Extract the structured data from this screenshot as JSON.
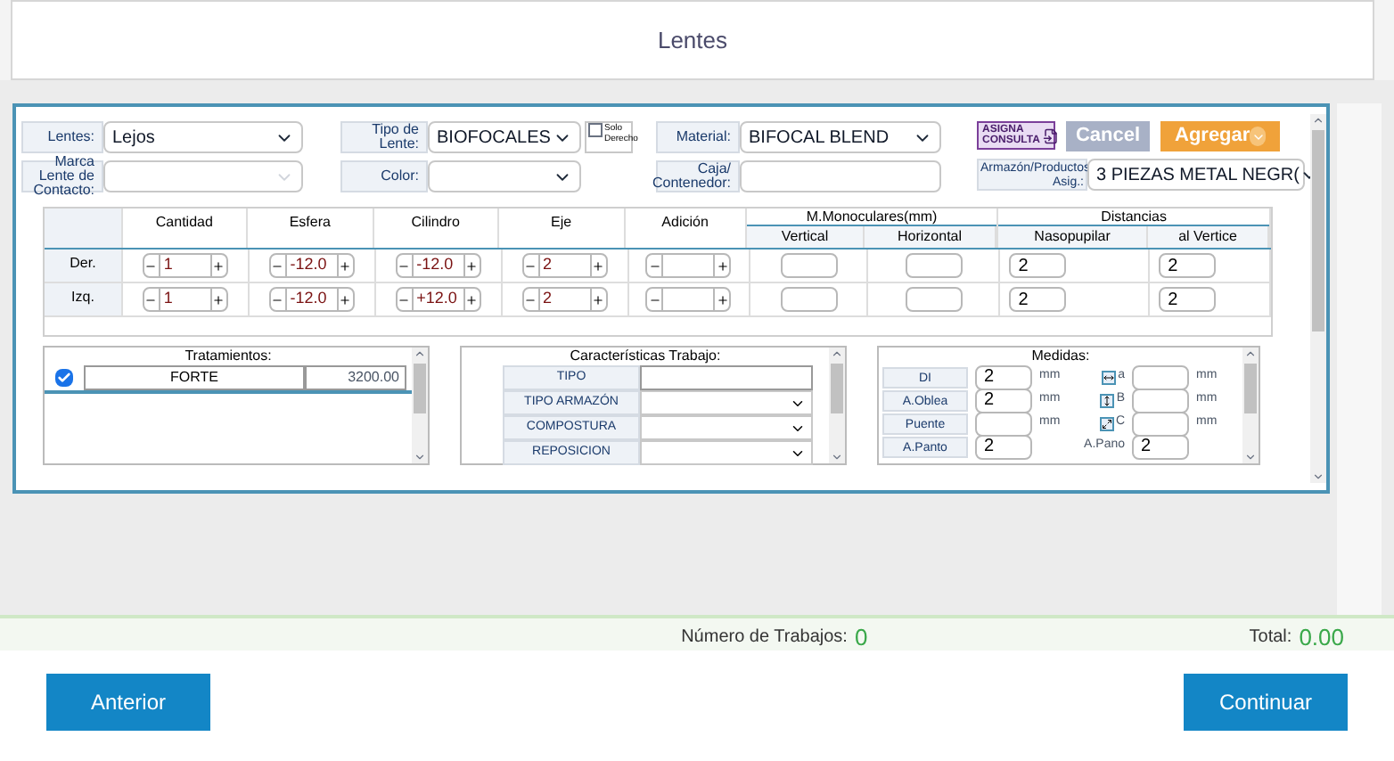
{
  "header": {
    "title": "Lentes"
  },
  "form": {
    "rows": [
      [
        {
          "label": "Lentes:",
          "value": "Lejos",
          "kind": "select"
        },
        {
          "label": "Tipo de Lente:",
          "value": "BIOFOCALES",
          "kind": "select",
          "checkbox": {
            "label": "Solo Derecho",
            "checked": false
          }
        },
        {
          "label": "Material:",
          "value": "BIFOCAL BLEND",
          "kind": "select"
        }
      ],
      [
        {
          "label": "Marca Lente de Contacto:",
          "kind": "select",
          "disabled": true
        },
        {
          "label": "Color:",
          "kind": "select"
        },
        {
          "label": "Caja/ Contenedor:",
          "kind": "text"
        }
      ]
    ],
    "actions": [
      {
        "label": "ASIGNA CONSULTA",
        "kind": "consulta"
      },
      {
        "label": "Cancel",
        "kind": "cancel"
      },
      {
        "label": "Agregar",
        "kind": "add"
      }
    ],
    "armazon": {
      "label": "Armazón/Productos Asig.:",
      "value": "3 PIEZAS METAL NEGR("
    }
  },
  "grid": {
    "groups": [
      "M.Monoculares(mm)",
      "Distancias"
    ],
    "columns": [
      {
        "label": "Cantidad",
        "kind": "spinner"
      },
      {
        "label": "Esfera",
        "kind": "spinner"
      },
      {
        "label": "Cilindro",
        "kind": "spinner"
      },
      {
        "label": "Eje",
        "kind": "spinner"
      },
      {
        "label": "Adición",
        "kind": "spinner"
      },
      {
        "label": "Vertical",
        "kind": "input"
      },
      {
        "label": "Horizontal",
        "kind": "input"
      },
      {
        "label": "Nasopupilar",
        "kind": "input"
      },
      {
        "label": "al Vertice",
        "kind": "input"
      }
    ],
    "rows": [
      {
        "label": "Der.",
        "cells": [
          {
            "value": "1"
          },
          {
            "value": "-12.0"
          },
          {
            "value": "-12.0"
          },
          {
            "value": "2"
          },
          {},
          {},
          {},
          {
            "value": "2"
          },
          {
            "value": "2"
          }
        ]
      },
      {
        "label": "Izq.",
        "cells": [
          {
            "value": "1"
          },
          {
            "value": "-12.0"
          },
          {
            "value": "+12.0"
          },
          {
            "value": "2"
          },
          {},
          {},
          {},
          {
            "value": "2"
          },
          {
            "value": "2"
          }
        ]
      }
    ]
  },
  "tratamientos": {
    "title": "Tratamientos:",
    "rows": [
      {
        "checked": true,
        "name": "FORTE",
        "price": "3200.00"
      }
    ]
  },
  "caracteristicas": {
    "title": "Características Trabajo:",
    "rows": [
      {
        "label": "TIPO",
        "kind": "text"
      },
      {
        "label": "TIPO ARMAZÓN",
        "kind": "select"
      },
      {
        "label": "COMPOSTURA",
        "kind": "select"
      },
      {
        "label": "REPOSICION",
        "kind": "select"
      }
    ]
  },
  "medidas": {
    "title": "Medidas:",
    "rows": [
      {
        "label": "DI",
        "value": "2",
        "unit": "mm",
        "side_label": "a",
        "side_unit": "mm"
      },
      {
        "label": "A.Oblea",
        "value": "2",
        "unit": "mm",
        "side_label": "B",
        "side_unit": "mm"
      },
      {
        "label": "Puente",
        "unit": "mm",
        "side_label": "C",
        "side_unit": "mm"
      },
      {
        "label": "A.Panto",
        "value": "2",
        "side_label": "A.Pano",
        "side_value": "2"
      }
    ]
  },
  "footer": {
    "jobs_label": "Número de Trabajos:",
    "jobs": "0",
    "total_label": "Total:",
    "total": "0.00"
  },
  "nav": [
    {
      "label": "Anterior"
    },
    {
      "label": "Continuar"
    }
  ]
}
